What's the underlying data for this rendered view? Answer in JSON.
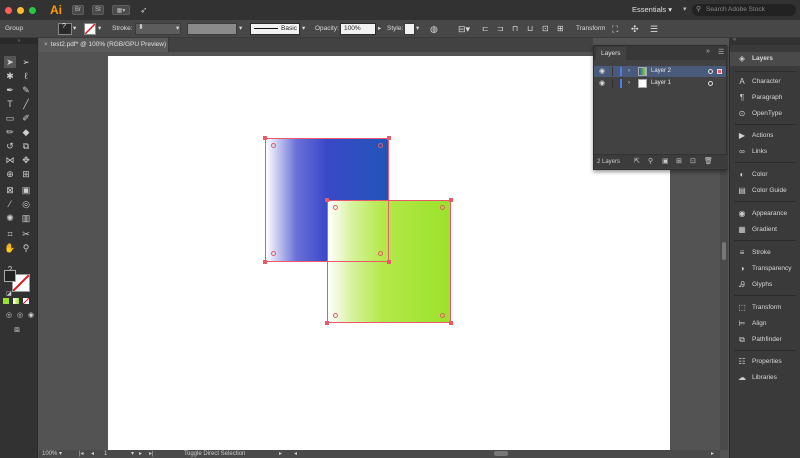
{
  "appbar": {
    "logo": "Ai",
    "br_label": "Br",
    "essentials": "Essentials",
    "search_placeholder": "Search Adobe Stock"
  },
  "controlbar": {
    "selection_label": "Group",
    "stroke_label": "Stroke:",
    "brush_label": "Basic",
    "opacity_label": "Opacity:",
    "opacity_value": "100%",
    "style_label": "Style:",
    "transform_label": "Transform"
  },
  "document": {
    "tab_title": "test2.pdf* @ 100% (RGB/GPU Preview)",
    "zoom": "100%",
    "artboard_number": "1",
    "status_text": "Toggle Direct Selection"
  },
  "layers_panel": {
    "title": "Layers",
    "layers": [
      {
        "name": "Layer 2",
        "color": "#4f7de6",
        "selected": true
      },
      {
        "name": "Layer 1",
        "color": "#4f7de6",
        "selected": false
      }
    ],
    "footer_count": "2 Layers"
  },
  "dock": {
    "items": [
      {
        "label": "Layers",
        "icon": "layers-icon"
      },
      {
        "label": "Character",
        "icon": "character-icon"
      },
      {
        "label": "Paragraph",
        "icon": "paragraph-icon"
      },
      {
        "label": "OpenType",
        "icon": "opentype-icon"
      },
      {
        "label": "Actions",
        "icon": "actions-icon"
      },
      {
        "label": "Links",
        "icon": "links-icon"
      },
      {
        "label": "Color",
        "icon": "color-icon"
      },
      {
        "label": "Color Guide",
        "icon": "color-guide-icon"
      },
      {
        "label": "Appearance",
        "icon": "appearance-icon"
      },
      {
        "label": "Gradient",
        "icon": "gradient-icon"
      },
      {
        "label": "Stroke",
        "icon": "stroke-icon"
      },
      {
        "label": "Transparency",
        "icon": "transparency-icon"
      },
      {
        "label": "Glyphs",
        "icon": "glyphs-icon"
      },
      {
        "label": "Transform",
        "icon": "transform-icon"
      },
      {
        "label": "Align",
        "icon": "align-icon"
      },
      {
        "label": "Pathfinder",
        "icon": "pathfinder-icon"
      },
      {
        "label": "Properties",
        "icon": "properties-icon"
      },
      {
        "label": "Libraries",
        "icon": "libraries-icon"
      }
    ]
  },
  "colors": {
    "accent": "#ff9a00",
    "selection": "#e85a6a",
    "blue_fill": "#2155b8",
    "green_fill": "#9be22a"
  }
}
